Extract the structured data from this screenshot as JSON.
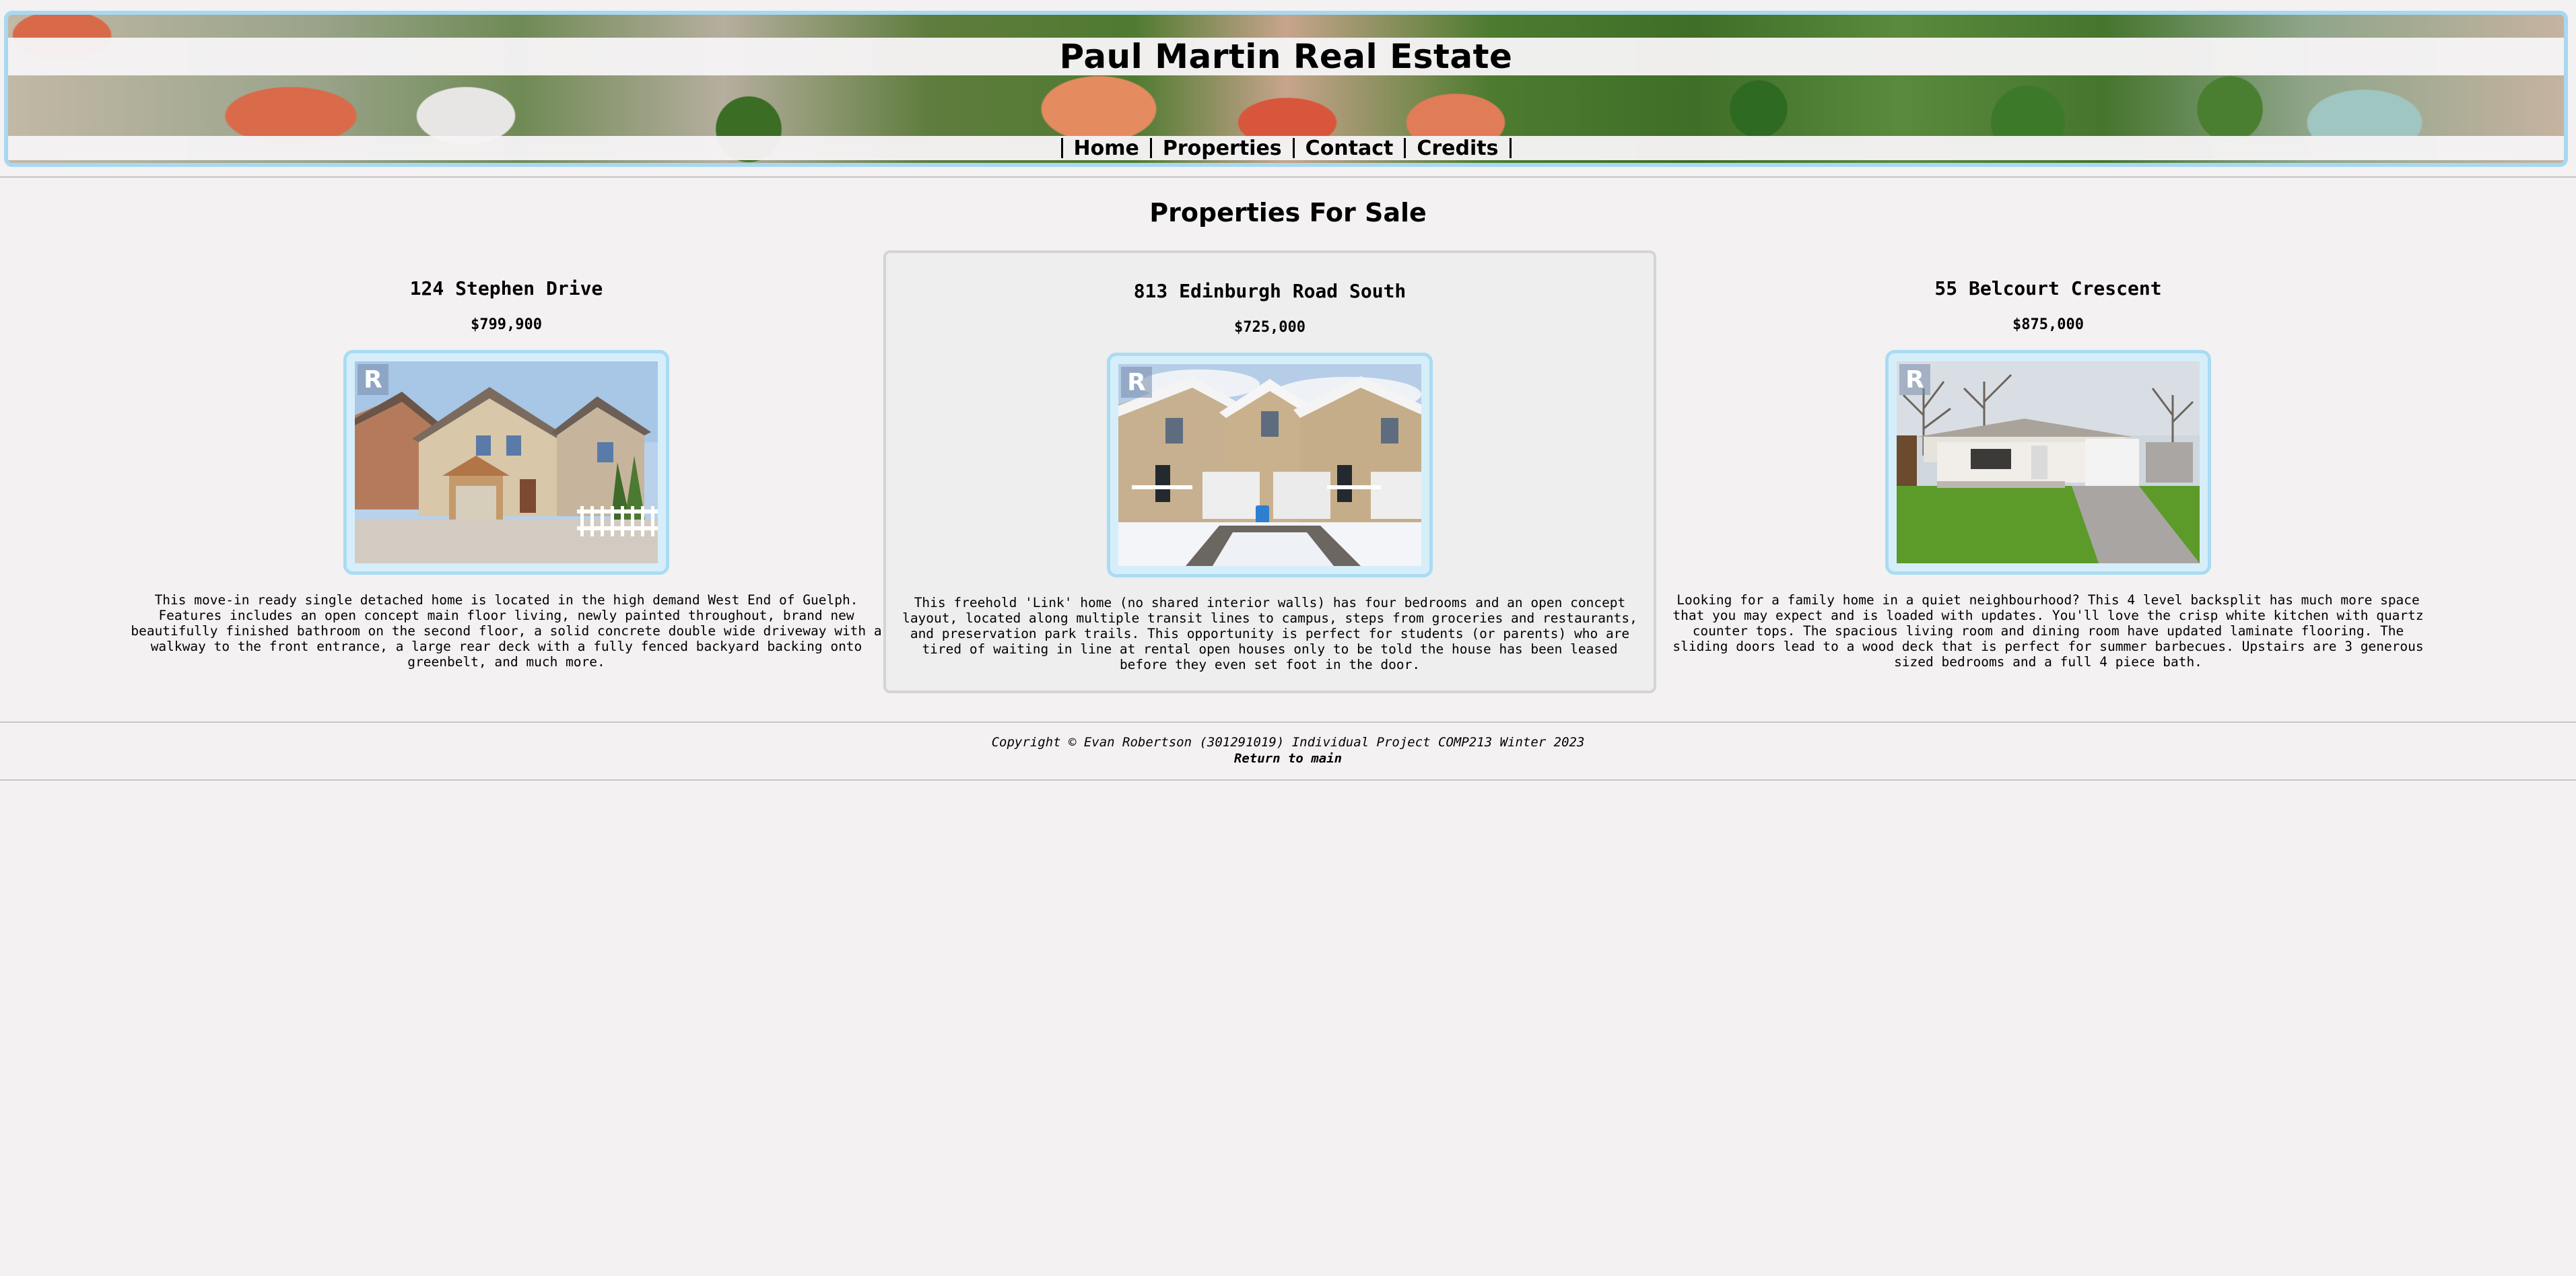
{
  "header": {
    "title": "Paul Martin Real Estate",
    "nav": [
      {
        "label": "Home"
      },
      {
        "label": "Properties"
      },
      {
        "label": "Contact"
      },
      {
        "label": "Credits"
      }
    ]
  },
  "main": {
    "heading": "Properties For Sale",
    "properties": [
      {
        "title": "124 Stephen Drive",
        "price": "$799,900",
        "description": "This move-in ready single detached home is located in the high demand West End of Guelph. Features includes an open concept main floor living, newly painted throughout, brand new beautifully finished bathroom on the second floor, a solid concrete double wide driveway with a walkway to the front entrance, a large rear deck with a fully fenced backyard backing onto greenbelt, and much more.",
        "badge": "R"
      },
      {
        "title": "813 Edinburgh Road South",
        "price": "$725,000",
        "description": "This freehold 'Link' home (no shared interior walls) has four bedrooms and an open concept layout, located along multiple transit lines to campus, steps from groceries and restaurants, and preservation park trails. This opportunity is perfect for students (or parents) who are tired of waiting in line at rental open houses only to be told the house has been leased before they even set foot in the door.",
        "badge": "R"
      },
      {
        "title": "55 Belcourt Crescent",
        "price": "$875,000",
        "description": "Looking for a family home in a quiet neighbourhood? This 4 level backsplit has much more space that you may expect and is loaded with updates. You'll love the crisp white kitchen with quartz counter tops. The spacious living room and dining room have updated laminate flooring. The sliding doors lead to a wood deck that is perfect for summer barbecues. Upstairs are 3 generous sized bedrooms and a full 4 piece bath.",
        "badge": "R"
      }
    ]
  },
  "footer": {
    "copyright": "Copyright © Evan Robertson (301291019) Individual Project COMP213 Winter 2023",
    "return_label": "Return to main"
  },
  "colors": {
    "background": "#f3f1f2",
    "frame_border": "#a9dcf3",
    "featured_card": "#eeeeee"
  }
}
